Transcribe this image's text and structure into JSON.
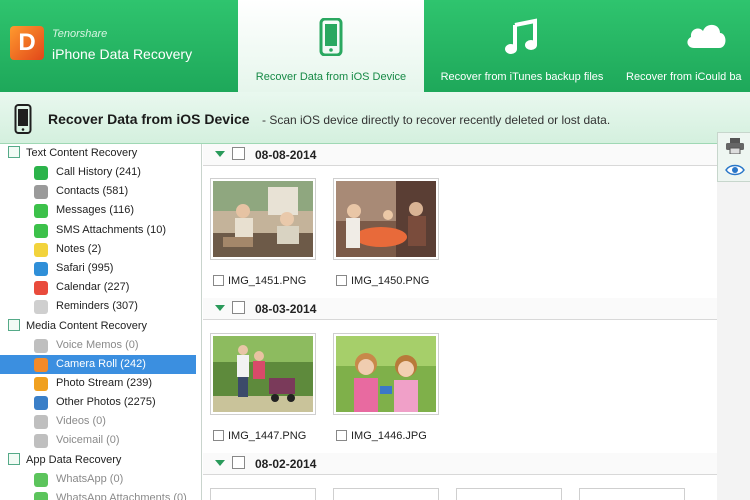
{
  "header": {
    "brand_small": "Tenorshare",
    "brand_big": "iPhone Data Recovery",
    "logo_letter": "D",
    "tabs": [
      {
        "label": "Recover Data from iOS Device",
        "icon": "phone-icon",
        "active": true
      },
      {
        "label": "Recover from iTunes backup files",
        "icon": "music-note-icon",
        "active": false
      },
      {
        "label": "Recover from iCould ba",
        "icon": "cloud-icon",
        "active": false
      }
    ]
  },
  "subheader": {
    "title": "Recover Data from iOS Device",
    "description": "- Scan iOS device directly to recover recently deleted or lost data."
  },
  "sidebar": {
    "categories": [
      {
        "label": "Text Content Recovery",
        "items": [
          {
            "label": "Call History (241)",
            "icon": "phone-icon",
            "color": "#2bb34a"
          },
          {
            "label": "Contacts (581)",
            "icon": "contacts-icon",
            "color": "#9a9a9a"
          },
          {
            "label": "Messages (116)",
            "icon": "message-icon",
            "color": "#3cc14a"
          },
          {
            "label": "SMS Attachments (10)",
            "icon": "paperclip-icon",
            "color": "#3cc14a"
          },
          {
            "label": "Notes (2)",
            "icon": "notes-icon",
            "color": "#f2d33c"
          },
          {
            "label": "Safari (995)",
            "icon": "compass-icon",
            "color": "#2f8fd8"
          },
          {
            "label": "Calendar (227)",
            "icon": "calendar-icon",
            "color": "#e94b3c"
          },
          {
            "label": "Reminders (307)",
            "icon": "reminders-icon",
            "color": "#cfcfcf"
          }
        ]
      },
      {
        "label": "Media Content Recovery",
        "items": [
          {
            "label": "Voice Memos (0)",
            "icon": "microphone-icon",
            "color": "#bfbfbf",
            "dim": true
          },
          {
            "label": "Camera Roll (242)",
            "icon": "flower-icon",
            "color": "#f28a2a",
            "selected": true
          },
          {
            "label": "Photo Stream (239)",
            "icon": "photo-stream-icon",
            "color": "#f0a020"
          },
          {
            "label": "Other Photos (2275)",
            "icon": "photos-icon",
            "color": "#3a7fc8"
          },
          {
            "label": "Videos (0)",
            "icon": "video-icon",
            "color": "#bfbfbf",
            "dim": true
          },
          {
            "label": "Voicemail (0)",
            "icon": "voicemail-icon",
            "color": "#bfbfbf",
            "dim": true
          }
        ]
      },
      {
        "label": "App Data Recovery",
        "items": [
          {
            "label": "WhatsApp (0)",
            "icon": "whatsapp-icon",
            "color": "#5cc45c",
            "dim": true
          },
          {
            "label": "WhatsApp Attachments (0)",
            "icon": "whatsapp-icon",
            "color": "#5cc45c",
            "dim": true
          }
        ]
      }
    ]
  },
  "groups": [
    {
      "date": "08-08-2014",
      "photos": [
        {
          "name": "IMG_1451.PNG"
        },
        {
          "name": "IMG_1450.PNG"
        }
      ]
    },
    {
      "date": "08-03-2014",
      "photos": [
        {
          "name": "IMG_1447.PNG"
        },
        {
          "name": "IMG_1446.JPG"
        }
      ]
    },
    {
      "date": "08-02-2014",
      "photos": []
    }
  ],
  "toolstrip": {
    "icons": [
      "printer-icon",
      "eye-icon"
    ]
  }
}
